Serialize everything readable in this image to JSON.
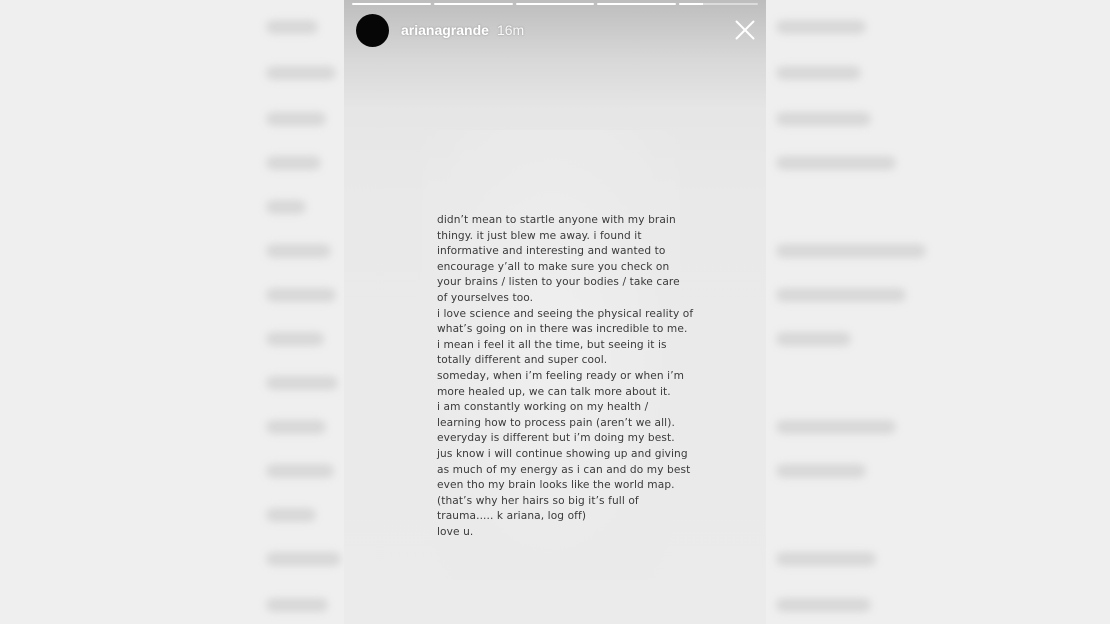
{
  "story": {
    "username": "arianagrande",
    "time": "16m",
    "progress": [
      1,
      1,
      1,
      1,
      0.3
    ],
    "note_lines": [
      "didn’t mean to startle anyone with my brain",
      "thingy. it just blew me away. i found it",
      "informative and interesting and wanted to",
      "encourage y’all to make sure you check on",
      "your brains / listen to your bodies / take care",
      "of yourselves too.",
      "i love science and seeing the physical reality of",
      "what’s going on in there was incredible to me.",
      "i mean i feel it all the time, but seeing it is",
      "totally different and super cool.",
      "someday, when i’m feeling ready or when i’m",
      "more healed up, we can talk more about it.",
      "i am constantly working on my health /",
      "learning how to process pain (aren’t we all).",
      "everyday is different but i’m doing my best.",
      "jus know i will continue showing up and giving",
      "as much of my energy as i can and do my best",
      "even tho my brain looks like the world map.",
      "(that’s why her hairs so big it’s full of",
      "trauma..... k ariana, log off)",
      "love u."
    ]
  },
  "icons": {
    "avatar": "avatar",
    "close": "close-icon"
  }
}
